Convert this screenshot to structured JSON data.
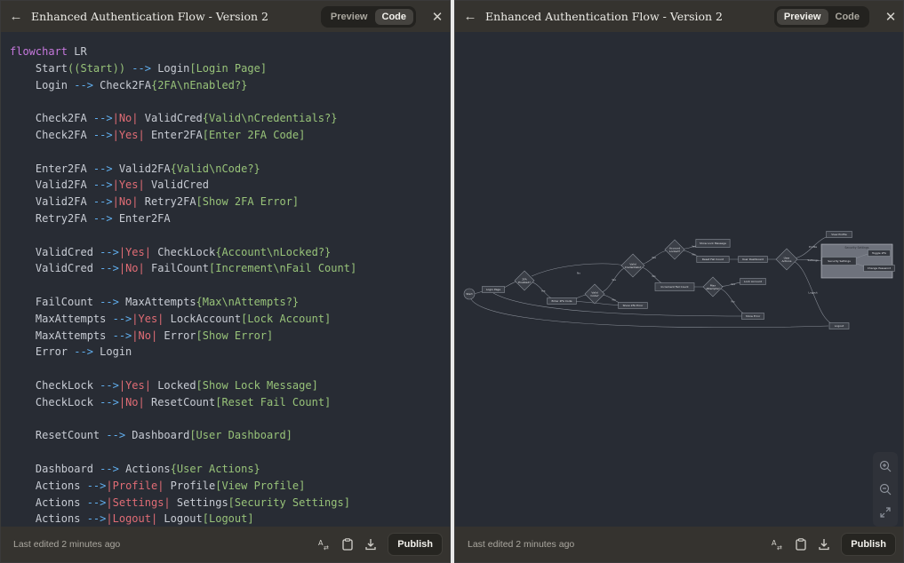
{
  "left_pane": {
    "title": "Enhanced Authentication Flow - Version 2",
    "toggle": {
      "preview": "Preview",
      "code": "Code",
      "active": "code"
    },
    "footer": {
      "edited": "Last edited 2 minutes ago",
      "publish": "Publish"
    }
  },
  "right_pane": {
    "title": "Enhanced Authentication Flow - Version 2",
    "toggle": {
      "preview": "Preview",
      "code": "Code",
      "active": "preview"
    },
    "footer": {
      "edited": "Last edited 2 minutes ago",
      "publish": "Publish"
    }
  },
  "code_lines": [
    "flowchart LR",
    "    Start((Start)) --> Login[Login Page]",
    "    Login --> Check2FA{2FA\\nEnabled?}",
    "",
    "    Check2FA -->|No| ValidCred{Valid\\nCredentials?}",
    "    Check2FA -->|Yes| Enter2FA[Enter 2FA Code]",
    "",
    "    Enter2FA --> Valid2FA{Valid\\nCode?}",
    "    Valid2FA -->|Yes| ValidCred",
    "    Valid2FA -->|No| Retry2FA[Show 2FA Error]",
    "    Retry2FA --> Enter2FA",
    "",
    "    ValidCred -->|Yes| CheckLock{Account\\nLocked?}",
    "    ValidCred -->|No| FailCount[Increment\\nFail Count]",
    "",
    "    FailCount --> MaxAttempts{Max\\nAttempts?}",
    "    MaxAttempts -->|Yes| LockAccount[Lock Account]",
    "    MaxAttempts -->|No| Error[Show Error]",
    "    Error --> Login",
    "",
    "    CheckLock -->|Yes| Locked[Show Lock Message]",
    "    CheckLock -->|No| ResetCount[Reset Fail Count]",
    "",
    "    ResetCount --> Dashboard[User Dashboard]",
    "",
    "    Dashboard --> Actions{User Actions}",
    "    Actions -->|Profile| Profile[View Profile]",
    "    Actions -->|Settings| Settings[Security Settings]",
    "    Actions -->|Logout| Logout[Logout]"
  ],
  "diagram": {
    "subgraph_title": "Security Settings",
    "nodes": [
      {
        "id": "Start",
        "label": "Start",
        "shape": "circle"
      },
      {
        "id": "Login",
        "label": "Login Page",
        "shape": "rect"
      },
      {
        "id": "Check2FA",
        "label": "2FA Enabled?",
        "shape": "diamond"
      },
      {
        "id": "Enter2FA",
        "label": "Enter 2FA Code",
        "shape": "rect"
      },
      {
        "id": "Valid2FA",
        "label": "Valid Code?",
        "shape": "diamond"
      },
      {
        "id": "Retry2FA",
        "label": "Show 2FA Error",
        "shape": "rect"
      },
      {
        "id": "ValidCred",
        "label": "Valid Credentials?",
        "shape": "diamond"
      },
      {
        "id": "CheckLock",
        "label": "Account Locked?",
        "shape": "diamond"
      },
      {
        "id": "Locked",
        "label": "Show Lock Message",
        "shape": "rect"
      },
      {
        "id": "ResetCount",
        "label": "Reset Fail Count",
        "shape": "rect"
      },
      {
        "id": "FailCount",
        "label": "Increment Fail Count",
        "shape": "rect"
      },
      {
        "id": "MaxAttempts",
        "label": "Max Attempts?",
        "shape": "diamond"
      },
      {
        "id": "LockAccount",
        "label": "Lock Account",
        "shape": "rect"
      },
      {
        "id": "Error",
        "label": "Show Error",
        "shape": "rect"
      },
      {
        "id": "Dashboard",
        "label": "User Dashboard",
        "shape": "rect"
      },
      {
        "id": "Actions",
        "label": "User Actions",
        "shape": "diamond"
      },
      {
        "id": "Profile",
        "label": "View Profile",
        "shape": "rect"
      },
      {
        "id": "Settings",
        "label": "Security Settings",
        "shape": "rect"
      },
      {
        "id": "Toggle2FA",
        "label": "Toggle 2FA",
        "shape": "rect"
      },
      {
        "id": "ChangePassword",
        "label": "Change Password",
        "shape": "rect"
      },
      {
        "id": "Logout",
        "label": "Logout",
        "shape": "rect"
      }
    ],
    "edges": [
      {
        "from": "Start",
        "to": "Login",
        "label": ""
      },
      {
        "from": "Login",
        "to": "Check2FA",
        "label": ""
      },
      {
        "from": "Check2FA",
        "to": "ValidCred",
        "label": "No"
      },
      {
        "from": "Check2FA",
        "to": "Enter2FA",
        "label": "Yes"
      },
      {
        "from": "Enter2FA",
        "to": "Valid2FA",
        "label": ""
      },
      {
        "from": "Valid2FA",
        "to": "ValidCred",
        "label": "Yes"
      },
      {
        "from": "Valid2FA",
        "to": "Retry2FA",
        "label": "No"
      },
      {
        "from": "Retry2FA",
        "to": "Enter2FA",
        "label": ""
      },
      {
        "from": "ValidCred",
        "to": "CheckLock",
        "label": "Yes"
      },
      {
        "from": "ValidCred",
        "to": "FailCount",
        "label": "No"
      },
      {
        "from": "FailCount",
        "to": "MaxAttempts",
        "label": ""
      },
      {
        "from": "MaxAttempts",
        "to": "LockAccount",
        "label": "Yes"
      },
      {
        "from": "MaxAttempts",
        "to": "Error",
        "label": "No"
      },
      {
        "from": "Error",
        "to": "Login",
        "label": ""
      },
      {
        "from": "CheckLock",
        "to": "Locked",
        "label": "Yes"
      },
      {
        "from": "CheckLock",
        "to": "ResetCount",
        "label": "No"
      },
      {
        "from": "ResetCount",
        "to": "Dashboard",
        "label": ""
      },
      {
        "from": "Dashboard",
        "to": "Actions",
        "label": ""
      },
      {
        "from": "Actions",
        "to": "Profile",
        "label": "Profile"
      },
      {
        "from": "Actions",
        "to": "Settings",
        "label": "Settings"
      },
      {
        "from": "Actions",
        "to": "Logout",
        "label": "Logout"
      },
      {
        "from": "Settings",
        "to": "Toggle2FA",
        "label": ""
      },
      {
        "from": "Settings",
        "to": "ChangePassword",
        "label": ""
      },
      {
        "from": "Logout",
        "to": "Start",
        "label": ""
      }
    ]
  },
  "zoom_controls": [
    "zoom-in",
    "zoom-out",
    "fit-view"
  ]
}
